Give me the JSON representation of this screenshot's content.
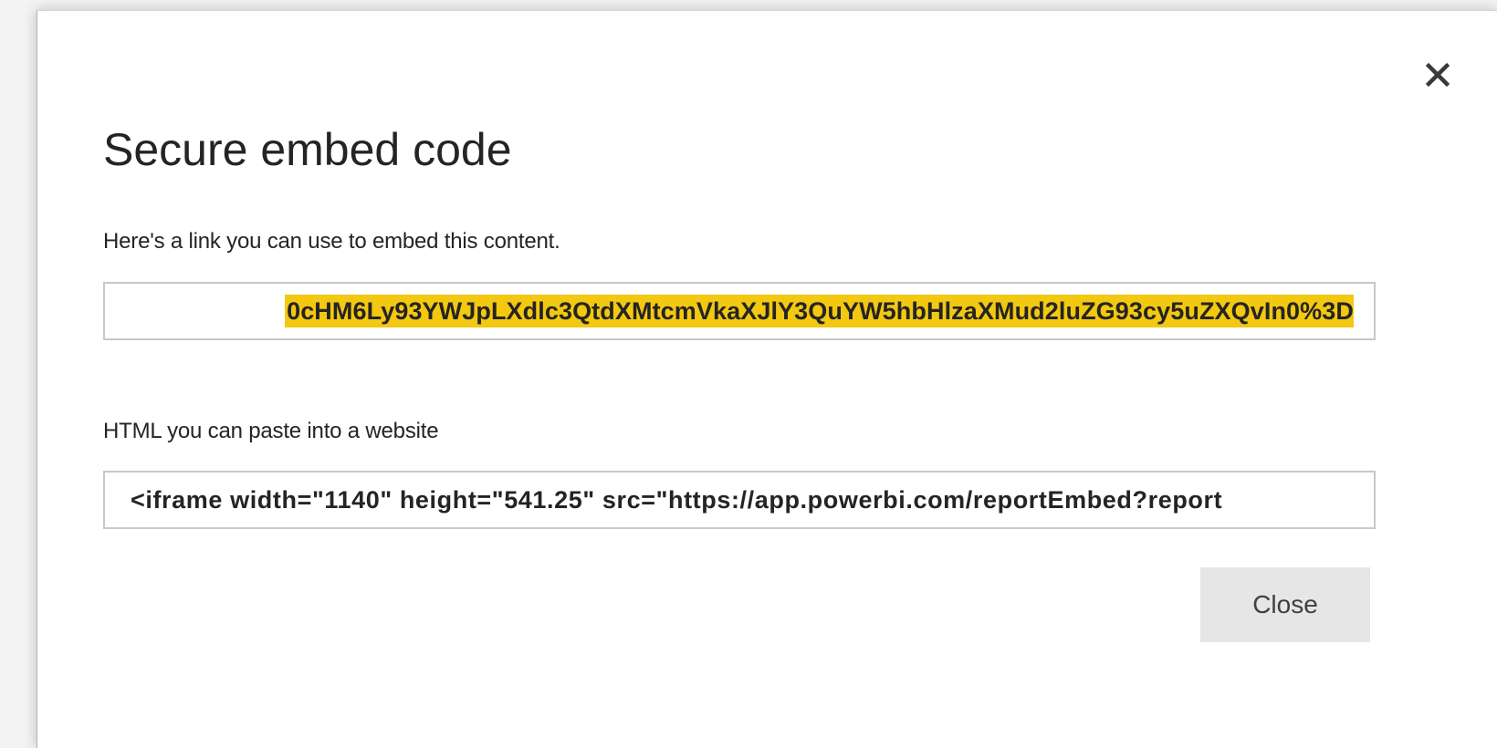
{
  "dialog": {
    "title": "Secure embed code",
    "close_icon": "close-icon",
    "link_label": "Here's a link you can use to embed this content.",
    "link_value": "0cHM6Ly93YWJpLXdlc3QtdXMtcmVkaXJlY3QuYW5hbHlzaXMud2luZG93cy5uZXQvIn0%3D",
    "html_label": "HTML you can paste into a website",
    "html_value": "<iframe width=\"1140\" height=\"541.25\" src=\"https://app.powerbi.com/reportEmbed?report",
    "close_button_label": "Close"
  },
  "colors": {
    "selection_highlight": "#f2c811",
    "text": "#252423",
    "field_border": "#c8c8c8",
    "button_bg": "#e6e6e6"
  }
}
